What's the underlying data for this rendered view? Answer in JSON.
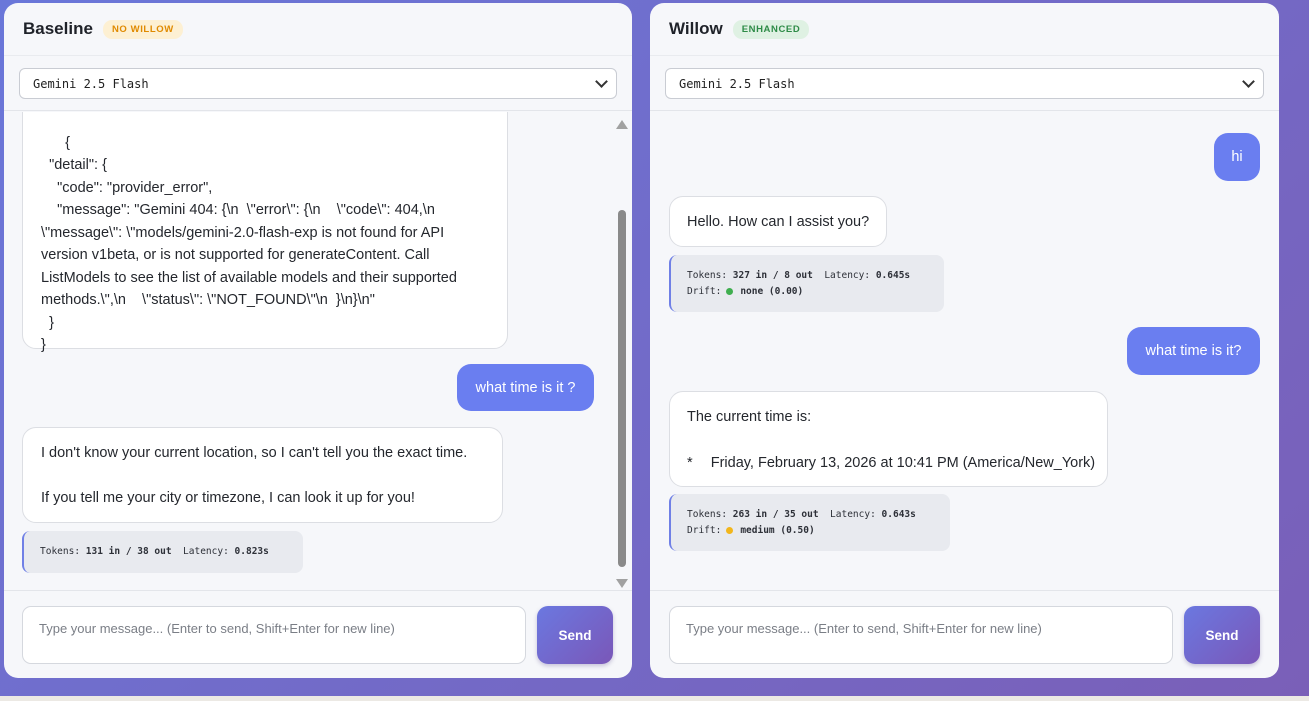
{
  "baseline": {
    "title": "Baseline",
    "badge": "NO WILLOW",
    "model": "Gemini 2.5 Flash",
    "error_json": "{\n  \"detail\": {\n    \"code\": \"provider_error\",\n    \"message\": \"Gemini 404: {\\n  \\\"error\\\": {\\n    \\\"code\\\": 404,\\n\n\\\"message\\\": \\\"models/gemini-2.0-flash-exp is not found for API\nversion v1beta, or is not supported for generateContent. Call\nListModels to see the list of available models and their supported\nmethods.\\\",\\n    \\\"status\\\": \\\"NOT_FOUND\\\"\\n  }\\n}\\n\"\n  }\n}",
    "user_msg": "what time is it ?",
    "bot_line1": "I don't know your current location, so I can't tell you the exact time.",
    "bot_line2": "If you tell me your city or timezone, I can look it up for you!",
    "meta_tokens_label": "Tokens:",
    "meta_tokens": "131 in / 38 out",
    "meta_latency_label": "Latency:",
    "meta_latency": "0.823s",
    "placeholder": "Type your message... (Enter to send, Shift+Enter for new line)",
    "send": "Send"
  },
  "willow": {
    "title": "Willow",
    "badge": "ENHANCED",
    "model": "Gemini 2.5 Flash",
    "user_msg1": "hi",
    "bot_msg1": "Hello. How can I assist you?",
    "meta1_tokens": "327 in / 8 out",
    "meta1_latency": "0.645s",
    "meta1_drift": "none (0.00)",
    "meta1_drift_color": "#3fae4f",
    "user_msg2": "what time is it?",
    "bot_msg2_line1": "The current time is:",
    "bot_msg2_bullet": "*",
    "bot_msg2_line2": "Friday, February 13, 2026 at 10:41 PM (America/New_York)",
    "meta2_tokens": "263 in / 35 out",
    "meta2_latency": "0.643s",
    "meta2_drift": "medium (0.50)",
    "meta2_drift_color": "#f2b61c",
    "tokens_label": "Tokens:",
    "latency_label": "Latency:",
    "drift_label": "Drift:",
    "placeholder": "Type your message... (Enter to send, Shift+Enter for new line)",
    "send": "Send"
  }
}
